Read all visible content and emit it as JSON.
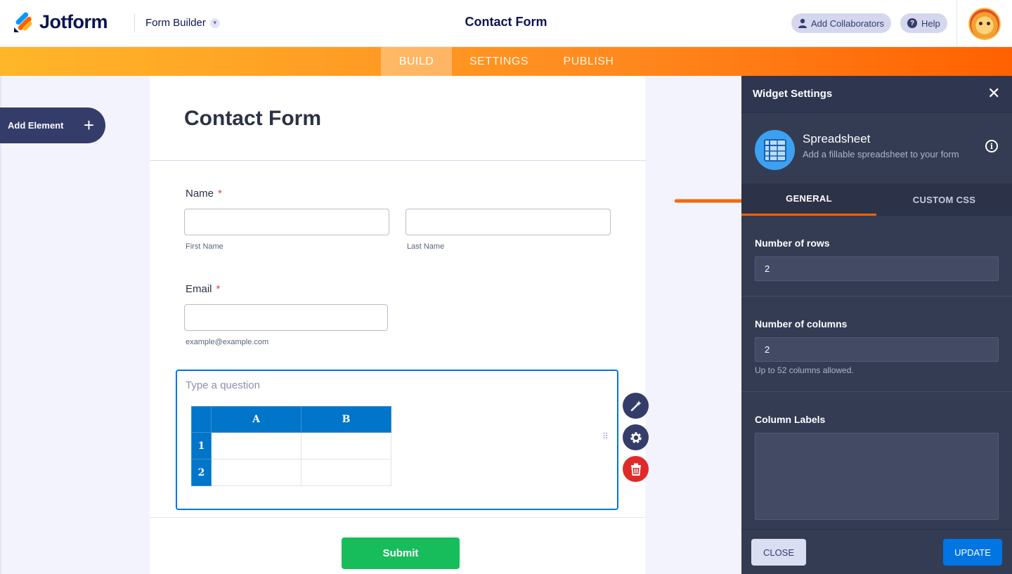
{
  "header": {
    "brand": "Jotform",
    "builder_menu": "Form Builder",
    "title": "Contact Form",
    "collaborators_label": "Add Collaborators",
    "help_label": "Help"
  },
  "nav": {
    "tabs": [
      {
        "label": "BUILD",
        "active": true
      },
      {
        "label": "SETTINGS",
        "active": false
      },
      {
        "label": "PUBLISH",
        "active": false
      }
    ]
  },
  "sidebar": {
    "add_element_label": "Add Element"
  },
  "form": {
    "title": "Contact Form",
    "name_label": "Name",
    "required_mark": "*",
    "first_name_sublabel": "First Name",
    "last_name_sublabel": "Last Name",
    "email_label": "Email",
    "email_sublabel": "example@example.com",
    "question_placeholder": "Type a question",
    "spreadsheet": {
      "columns": [
        "A",
        "B"
      ],
      "rows": [
        "1",
        "2"
      ]
    },
    "submit_label": "Submit"
  },
  "panel": {
    "title": "Widget Settings",
    "widget_name": "Spreadsheet",
    "widget_description": "Add a fillable spreadsheet to your form",
    "tabs": [
      {
        "label": "GENERAL",
        "active": true
      },
      {
        "label": "CUSTOM CSS",
        "active": false
      }
    ],
    "rows_label": "Number of rows",
    "rows_value": "2",
    "columns_label": "Number of columns",
    "columns_value": "2",
    "columns_hint": "Up to 52 columns allowed.",
    "column_labels_label": "Column Labels",
    "column_labels_value": "",
    "close_label": "CLOSE",
    "update_label": "UPDATE"
  },
  "colors": {
    "accent_orange": "#ff6100",
    "primary_blue": "#0075e3",
    "submit_green": "#18bd5b",
    "panel_bg": "#343c54"
  }
}
